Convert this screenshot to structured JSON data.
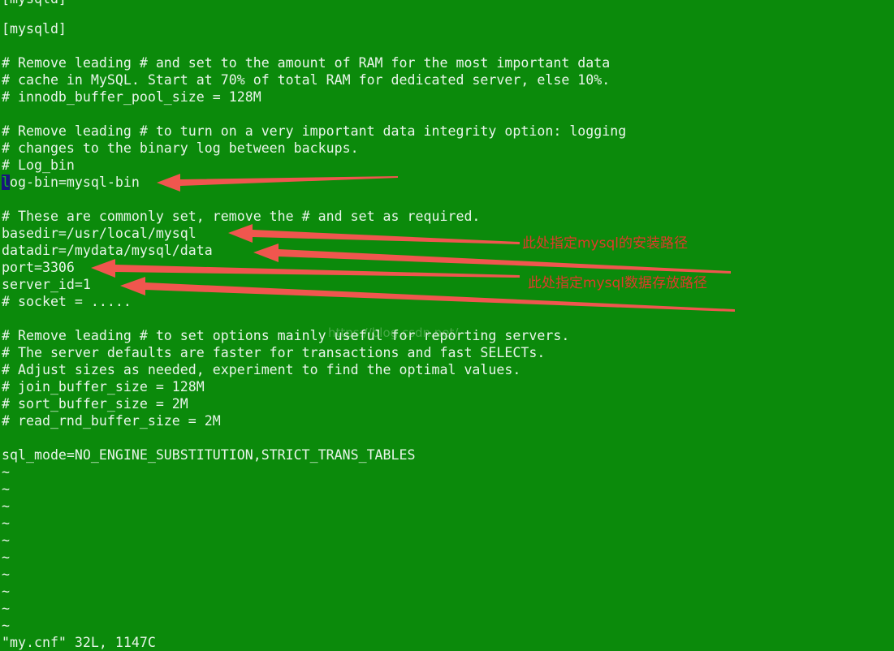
{
  "terminal": {
    "background_color": "#0b8a0b",
    "text_color": "#e8f5e9",
    "cursor_color": "#16177a",
    "cursor_text_color": "#14c014",
    "annotation_color": "#f0564e",
    "chinese_note_color": "#e03a2a",
    "partial_top_line": "[mysqld]",
    "lines": [
      "[mysqld]",
      "",
      "# Remove leading # and set to the amount of RAM for the most important data",
      "# cache in MySQL. Start at 70% of total RAM for dedicated server, else 10%.",
      "# innodb_buffer_pool_size = 128M",
      "",
      "# Remove leading # to turn on a very important data integrity option: logging",
      "# changes to the binary log between backups.",
      "# Log_bin",
      "",
      "# These are commonly set, remove the # and set as required.",
      "basedir=/usr/local/mysql",
      "datadir=/mydata/mysql/data",
      "port=3306",
      "server_id=1",
      "# socket = .....",
      "",
      "# Remove leading # to set options mainly useful for reporting servers.",
      "# The server defaults are faster for transactions and fast SELECTs.",
      "# Adjust sizes as needed, experiment to find the optimal values.",
      "# join_buffer_size = 128M",
      "# sort_buffer_size = 2M",
      "# read_rnd_buffer_size = 2M",
      "",
      "sql_mode=NO_ENGINE_SUBSTITUTION,STRICT_TRANS_TABLES"
    ],
    "cursor_line": {
      "cursor_char": "l",
      "rest": "og-bin=mysql-bin"
    },
    "tilde_count": 10,
    "tilde_char": "~",
    "status_line": "\"my.cnf\" 32L, 1147C"
  },
  "annotations": {
    "notes": [
      {
        "text": "此处指定mysql的安装路径"
      },
      {
        "text": "此处指定mysql数据存放路径"
      }
    ],
    "arrow_count": 5
  },
  "watermark": {
    "text": "https://blog.csdn.net/"
  }
}
